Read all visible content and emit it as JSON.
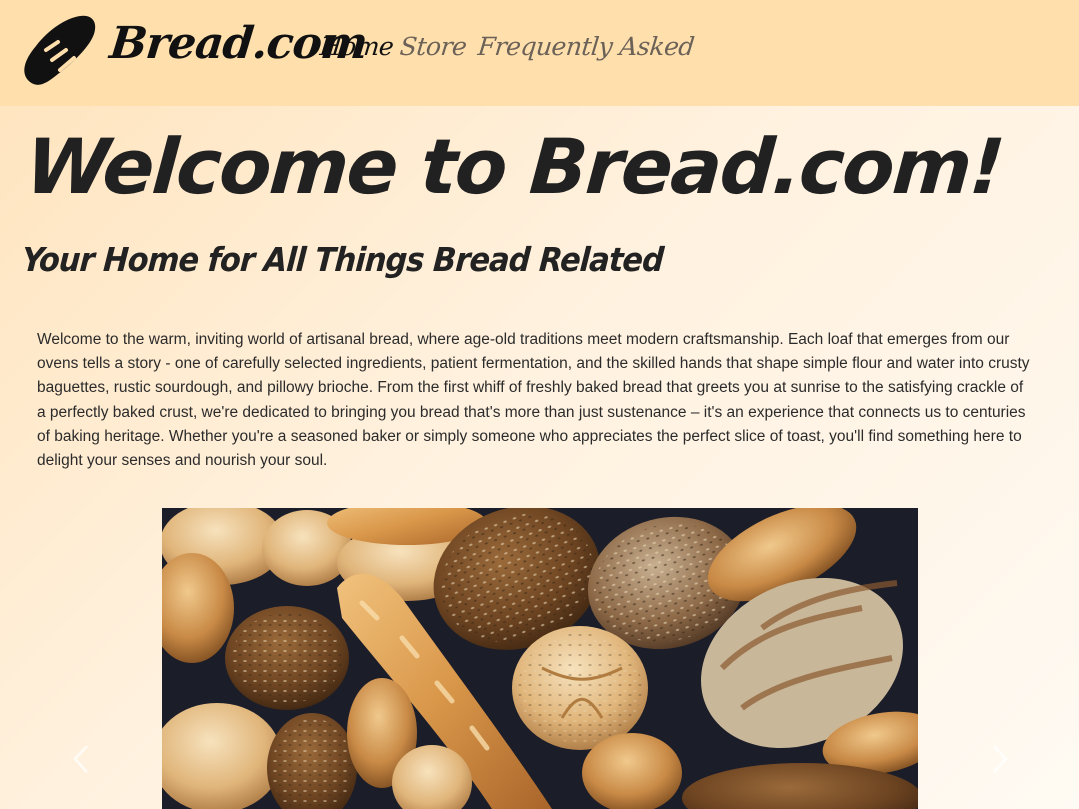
{
  "navbar": {
    "logo_icon": "bread-loaf-icon",
    "brand": "Bread.com",
    "links": [
      {
        "label": "Home",
        "active": true
      },
      {
        "label": "Store",
        "active": false
      },
      {
        "label": "Frequently Asked",
        "active": false
      }
    ]
  },
  "hero": {
    "title": "Welcome to Bread.com!",
    "subtitle": "Your Home for All Things Bread Related",
    "intro": "Welcome to the warm, inviting world of artisanal bread, where age-old traditions meet modern craftsmanship. Each loaf that emerges from our ovens tells a story - one of carefully selected ingredients, patient fermentation, and the skilled hands that shape simple flour and water into crusty baguettes, rustic sourdough, and pillowy brioche. From the first whiff of freshly baked bread that greets you at sunrise to the satisfying crackle of a perfectly baked crust, we're dedicated to bringing you bread that's more than just sustenance – it's an experience that connects us to centuries of baking heritage. Whether you're a seasoned baker or simply someone who appreciates the perfect slice of toast, you'll find something here to delight your senses and nourish your soul."
  },
  "carousel": {
    "prev_icon": "chevron-left-icon",
    "next_icon": "chevron-right-icon"
  },
  "colors": {
    "navbar_bg": "#ffe0ad",
    "page_bg_start": "#ffe3bb",
    "page_bg_end": "#fffaf3",
    "text_dark": "#212121",
    "nav_inactive": "#6b6157"
  }
}
